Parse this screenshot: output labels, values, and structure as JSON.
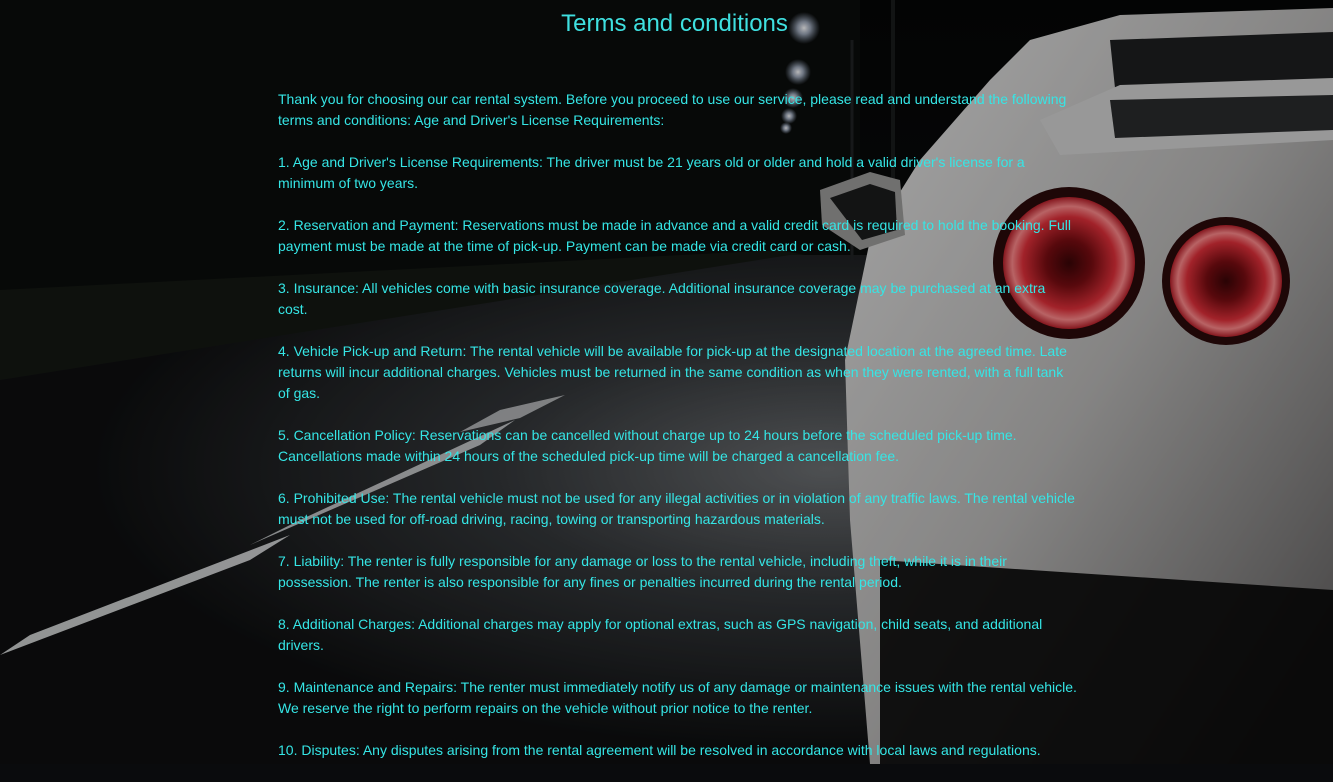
{
  "page": {
    "title": "Terms and conditions",
    "accent_color": "#3fe0e0",
    "background": "night road with white sports car, red tail lights"
  },
  "terms": {
    "intro": "Thank you for choosing our car rental system. Before you proceed to use our service, please read and understand the following terms and conditions: Age and Driver's License Requirements:",
    "items": [
      "1. Age and Driver's License Requirements: The driver must be 21 years old or older and hold a valid driver's license for a minimum of two years.",
      "2. Reservation and Payment: Reservations must be made in advance and a valid credit card is required to hold the booking. Full payment must be made at the time of pick-up. Payment can be made via credit card or cash.",
      "3. Insurance: All vehicles come with basic insurance coverage. Additional insurance coverage may be purchased at an extra cost.",
      "4. Vehicle Pick-up and Return: The rental vehicle will be available for pick-up at the designated location at the agreed time. Late returns will incur additional charges. Vehicles must be returned in the same condition as when they were rented, with a full tank of gas.",
      "5. Cancellation Policy: Reservations can be cancelled without charge up to 24 hours before the scheduled pick-up time. Cancellations made within 24 hours of the scheduled pick-up time will be charged a cancellation fee.",
      "6. Prohibited Use: The rental vehicle must not be used for any illegal activities or in violation of any traffic laws. The rental vehicle must not be used for off-road driving, racing, towing or transporting hazardous materials.",
      "7. Liability: The renter is fully responsible for any damage or loss to the rental vehicle, including theft, while it is in their possession. The renter is also responsible for any fines or penalties incurred during the rental period.",
      "8. Additional Charges: Additional charges may apply for optional extras, such as GPS navigation, child seats, and additional drivers.",
      "9. Maintenance and Repairs: The renter must immediately notify us of any damage or maintenance issues with the rental vehicle. We reserve the right to perform repairs on the vehicle without prior notice to the renter.",
      "10. Disputes: Any disputes arising from the rental agreement will be resolved in accordance with local laws and regulations."
    ]
  }
}
